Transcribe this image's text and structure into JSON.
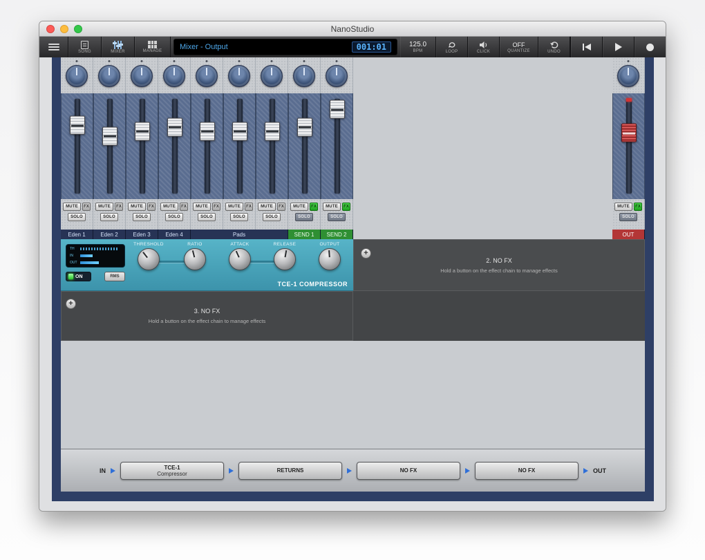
{
  "window": {
    "title": "NanoStudio"
  },
  "toolbar": {
    "song": "SONG",
    "mixer": "MIXER",
    "manage": "MANAGE",
    "display_title": "Mixer - Output",
    "timecode": "001:01",
    "bpm": "125.0",
    "bpm_label": "BPM",
    "loop": "LOOP",
    "click": "CLICK",
    "quantize_value": "OFF",
    "quantize_label": "QUANTIZE",
    "undo": "UNDO"
  },
  "mixer": {
    "mute_label": "MUTE",
    "solo_label": "SOLO",
    "fx_label": "FX",
    "channels": [
      {
        "fader": 0.75,
        "fx_active": false
      },
      {
        "fader": 0.62,
        "fx_active": false
      },
      {
        "fader": 0.68,
        "fx_active": false
      },
      {
        "fader": 0.73,
        "fx_active": false
      },
      {
        "fader": 0.68,
        "fx_active": false
      },
      {
        "fader": 0.68,
        "fx_active": false
      },
      {
        "fader": 0.68,
        "fx_active": false
      },
      {
        "fader": 0.73,
        "fx_active": true
      },
      {
        "fader": 0.94,
        "fx_active": true
      }
    ],
    "labels": [
      {
        "text": "Eden 1",
        "span": 1,
        "type": "track"
      },
      {
        "text": "Eden 2",
        "span": 1,
        "type": "track"
      },
      {
        "text": "Eden 3",
        "span": 1,
        "type": "track"
      },
      {
        "text": "Eden 4",
        "span": 1,
        "type": "track"
      },
      {
        "text": "Pads",
        "span": 3,
        "type": "track"
      },
      {
        "text": "SEND 1",
        "span": 1,
        "type": "send"
      },
      {
        "text": "SEND 2",
        "span": 1,
        "type": "send"
      }
    ],
    "out": {
      "label": "OUT",
      "fader": 0.66,
      "fx_active": true
    }
  },
  "compressor": {
    "title": "TCE-1 COMPRESSOR",
    "on": "ON",
    "rms": "RMS",
    "display": [
      "TH",
      "IN",
      "OUT"
    ],
    "knobs": [
      {
        "label": "THRESHOLD",
        "angle": -38
      },
      {
        "label": "RATIO",
        "angle": -14
      },
      {
        "label": "ATTACK",
        "angle": -24
      },
      {
        "label": "RELEASE",
        "angle": 10
      },
      {
        "label": "OUTPUT",
        "angle": -4
      }
    ]
  },
  "fx_slots": {
    "add_label": "+",
    "slot2": {
      "title": "2. NO FX",
      "hint": "Hold a button on the effect chain to manage effects"
    },
    "slot3": {
      "title": "3. NO FX",
      "hint": "Hold a button on the effect chain to manage effects"
    }
  },
  "chain": {
    "in": "IN",
    "out": "OUT",
    "nodes": [
      {
        "line1": "TCE-1",
        "line2": "Compressor"
      },
      {
        "line1": "RETURNS",
        "line2": ""
      },
      {
        "line1": "NO FX",
        "line2": ""
      },
      {
        "line1": "NO FX",
        "line2": ""
      }
    ]
  },
  "colors": {
    "frame_navy": "#2e3f66",
    "lcd_text_blue": "#4da6e8",
    "send_green": "#2f8f33",
    "out_red": "#b33636",
    "compressor_teal": "#45a4ba",
    "fx_active_green": "#35c535",
    "fader_cap_red": "#c23b3b",
    "chain_arrow_blue": "#2f6fd8"
  }
}
